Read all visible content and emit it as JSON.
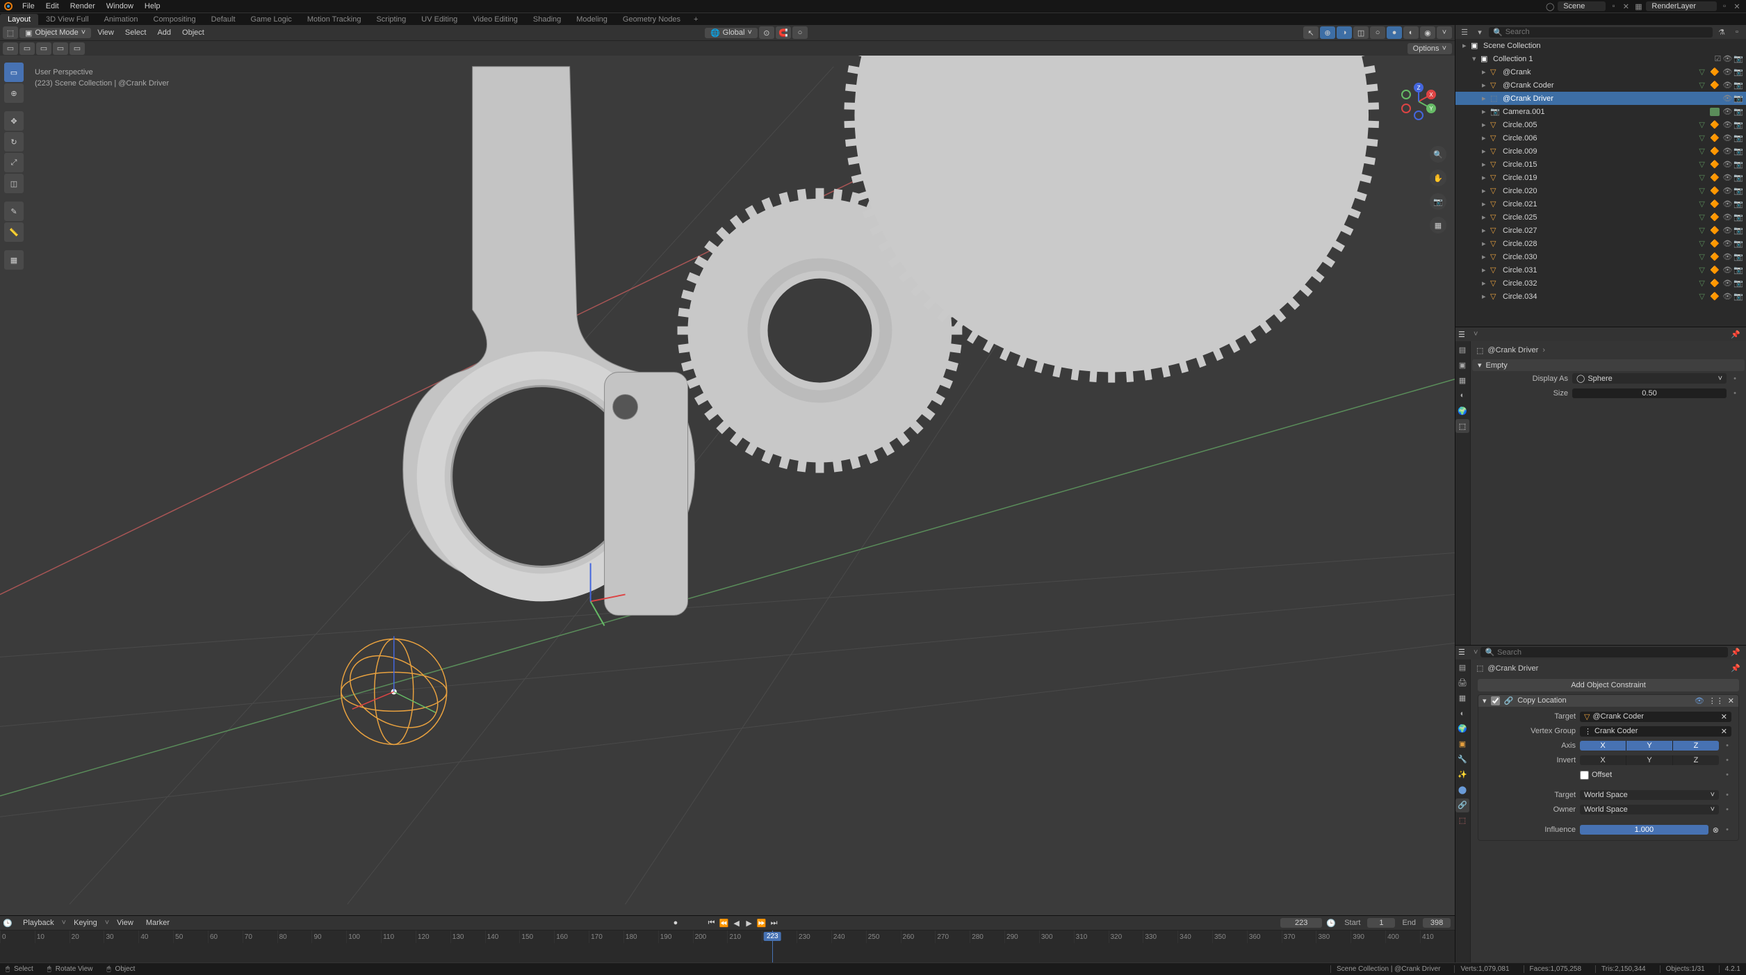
{
  "main_menu": {
    "items": [
      "File",
      "Edit",
      "Render",
      "Window",
      "Help"
    ],
    "scene_label": "Scene",
    "layer_label": "RenderLayer"
  },
  "workspaces": {
    "tabs": [
      "Layout",
      "3D View Full",
      "Animation",
      "Compositing",
      "Default",
      "Game Logic",
      "Motion Tracking",
      "Scripting",
      "UV Editing",
      "Video Editing",
      "Shading",
      "Modeling",
      "Geometry Nodes"
    ],
    "active": "Layout"
  },
  "viewport": {
    "mode": "Object Mode",
    "menus": [
      "View",
      "Select",
      "Add",
      "Object"
    ],
    "orientation": "Global",
    "overlay_line1": "User Perspective",
    "overlay_line2": "(223) Scene Collection | @Crank Driver",
    "options_label": "Options"
  },
  "outliner": {
    "root": "Scene Collection",
    "collection": "Collection 1",
    "search_placeholder": "Search",
    "filter_placeholder": "Search",
    "items": [
      {
        "name": "@Crank",
        "type": "mesh"
      },
      {
        "name": "@Crank Coder",
        "type": "mesh"
      },
      {
        "name": "@Crank Driver",
        "type": "empty",
        "selected": true
      },
      {
        "name": "Camera.001",
        "type": "camera"
      },
      {
        "name": "Circle.005",
        "type": "mesh"
      },
      {
        "name": "Circle.006",
        "type": "mesh"
      },
      {
        "name": "Circle.009",
        "type": "mesh"
      },
      {
        "name": "Circle.015",
        "type": "mesh"
      },
      {
        "name": "Circle.019",
        "type": "mesh"
      },
      {
        "name": "Circle.020",
        "type": "mesh"
      },
      {
        "name": "Circle.021",
        "type": "mesh"
      },
      {
        "name": "Circle.025",
        "type": "mesh"
      },
      {
        "name": "Circle.027",
        "type": "mesh"
      },
      {
        "name": "Circle.028",
        "type": "mesh"
      },
      {
        "name": "Circle.030",
        "type": "mesh"
      },
      {
        "name": "Circle.031",
        "type": "mesh"
      },
      {
        "name": "Circle.032",
        "type": "mesh"
      },
      {
        "name": "Circle.034",
        "type": "mesh"
      }
    ]
  },
  "properties": {
    "breadcrumb": "@Crank Driver",
    "empty_panel_title": "Empty",
    "display_as_label": "Display As",
    "display_as_value": "Sphere",
    "size_label": "Size",
    "size_value": "0.50",
    "add_constraint_label": "Add Object Constraint",
    "search_placeholder": "Search",
    "constraint": {
      "name": "Copy Location",
      "target_label": "Target",
      "target_value": "@Crank Coder",
      "vertex_group_label": "Vertex Group",
      "vertex_group_value": "Crank Coder",
      "axis_label": "Axis",
      "invert_label": "Invert",
      "offset_label": "Offset",
      "target_space_label": "Target",
      "target_space_value": "World Space",
      "owner_label": "Owner",
      "owner_value": "World Space",
      "influence_label": "Influence",
      "influence_value": "1.000"
    }
  },
  "timeline": {
    "menus": [
      "Playback",
      "Keying",
      "View",
      "Marker"
    ],
    "current_frame": "223",
    "start_label": "Start",
    "start_value": "1",
    "end_label": "End",
    "end_value": "398",
    "ticks": [
      "0",
      "10",
      "20",
      "30",
      "40",
      "50",
      "60",
      "70",
      "80",
      "90",
      "100",
      "110",
      "120",
      "130",
      "140",
      "150",
      "160",
      "170",
      "180",
      "190",
      "200",
      "210",
      "220",
      "230",
      "240",
      "250",
      "260",
      "270",
      "280",
      "290",
      "300",
      "310",
      "320",
      "330",
      "340",
      "350",
      "360",
      "370",
      "380",
      "390",
      "400",
      "410"
    ]
  },
  "status": {
    "select": "Select",
    "rotate_view": "Rotate View",
    "object_menu": "Object",
    "context": "Scene Collection | @Crank Driver",
    "verts": "Verts:1,079,081",
    "faces": "Faces:1,075,258",
    "tris": "Tris:2,150,344",
    "objects": "Objects:1/31",
    "version": "4.2.1"
  }
}
